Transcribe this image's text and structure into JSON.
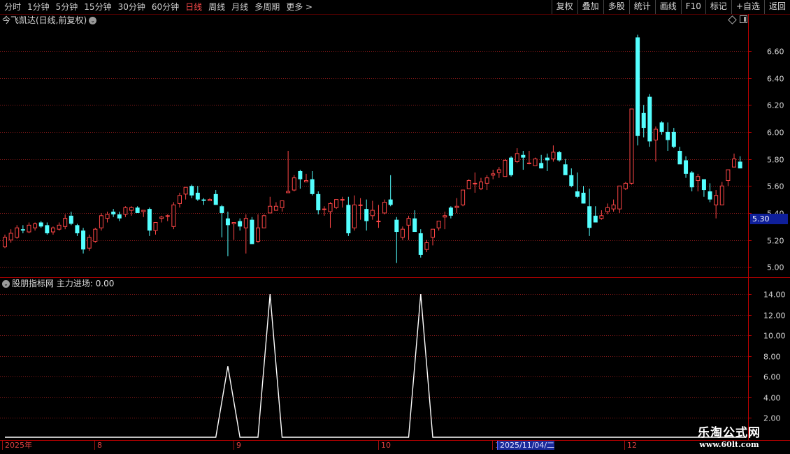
{
  "toolbar": {
    "periods": [
      "分时",
      "1分钟",
      "5分钟",
      "15分钟",
      "30分钟",
      "60分钟",
      "日线",
      "周线",
      "月线",
      "多周期",
      "更多 >"
    ],
    "active_period": "日线",
    "buttons": [
      "复权",
      "叠加",
      "多股",
      "统计",
      "画线",
      "F10",
      "标记",
      "+自选",
      "返回"
    ]
  },
  "main_panel": {
    "title": "今飞凯达(日线,前复权)",
    "current_price_label": "5.30"
  },
  "sub_panel": {
    "title": "股朋指标网",
    "indicator": "主力进场:",
    "indicator_value": "0.00"
  },
  "date_axis": {
    "labels": [
      "2025年",
      "8",
      "9",
      "10",
      "1",
      "2025/11/04/二",
      "12"
    ]
  },
  "watermark": {
    "title": "乐淘公式网",
    "url": "www.60lt.com"
  },
  "colors": {
    "up": "#ff4646",
    "down": "#54ffff",
    "grid": "#8c1a1a",
    "axis": "#c00000",
    "highlight_bg": "#1a2a9a"
  },
  "chart_data": [
    {
      "type": "candlestick",
      "title": "今飞凯达(日线,前复权)",
      "ylim": [
        4.95,
        6.78
      ],
      "y_ticks": [
        5.0,
        5.2,
        5.4,
        5.6,
        5.8,
        6.0,
        6.2,
        6.4,
        6.6
      ],
      "current_price": 5.3,
      "ohlc": [
        [
          5.15,
          5.24,
          5.14,
          5.22
        ],
        [
          5.2,
          5.28,
          5.18,
          5.25
        ],
        [
          5.22,
          5.31,
          5.21,
          5.29
        ],
        [
          5.28,
          5.31,
          5.25,
          5.27
        ],
        [
          5.26,
          5.33,
          5.25,
          5.31
        ],
        [
          5.29,
          5.33,
          5.27,
          5.32
        ],
        [
          5.33,
          5.34,
          5.29,
          5.3
        ],
        [
          5.31,
          5.33,
          5.24,
          5.25
        ],
        [
          5.26,
          5.3,
          5.24,
          5.29
        ],
        [
          5.28,
          5.33,
          5.27,
          5.31
        ],
        [
          5.3,
          5.39,
          5.28,
          5.36
        ],
        [
          5.38,
          5.41,
          5.31,
          5.32
        ],
        [
          5.31,
          5.32,
          5.23,
          5.25
        ],
        [
          5.27,
          5.29,
          5.1,
          5.13
        ],
        [
          5.14,
          5.24,
          5.12,
          5.22
        ],
        [
          5.19,
          5.29,
          5.18,
          5.28
        ],
        [
          5.29,
          5.4,
          5.27,
          5.38
        ],
        [
          5.36,
          5.41,
          5.33,
          5.39
        ],
        [
          5.41,
          5.43,
          5.37,
          5.39
        ],
        [
          5.39,
          5.41,
          5.34,
          5.36
        ],
        [
          5.39,
          5.45,
          5.37,
          5.44
        ],
        [
          5.42,
          5.45,
          5.38,
          5.44
        ],
        [
          5.44,
          5.45,
          5.4,
          5.4
        ],
        [
          5.41,
          5.42,
          5.37,
          5.42
        ],
        [
          5.43,
          5.44,
          5.23,
          5.27
        ],
        [
          5.27,
          5.33,
          5.24,
          5.33
        ],
        [
          5.36,
          5.38,
          5.33,
          5.37
        ],
        [
          5.38,
          5.39,
          5.34,
          5.38
        ],
        [
          5.3,
          5.48,
          5.28,
          5.46
        ],
        [
          5.47,
          5.55,
          5.44,
          5.53
        ],
        [
          5.54,
          5.56,
          5.5,
          5.59
        ],
        [
          5.6,
          5.61,
          5.51,
          5.53
        ],
        [
          5.55,
          5.6,
          5.49,
          5.5
        ],
        [
          5.5,
          5.51,
          5.46,
          5.49
        ],
        [
          5.49,
          5.51,
          5.49,
          5.5
        ],
        [
          5.54,
          5.57,
          5.46,
          5.46
        ],
        [
          5.45,
          5.46,
          5.22,
          5.4
        ],
        [
          5.36,
          5.41,
          5.08,
          5.31
        ],
        [
          5.32,
          5.33,
          5.2,
          5.33
        ],
        [
          5.34,
          5.36,
          5.27,
          5.3
        ],
        [
          5.29,
          5.39,
          5.1,
          5.36
        ],
        [
          5.35,
          5.37,
          5.17,
          5.17
        ],
        [
          5.19,
          5.39,
          5.18,
          5.29
        ],
        [
          5.29,
          5.39,
          5.3,
          5.38
        ],
        [
          5.4,
          5.52,
          5.4,
          5.45
        ],
        [
          5.42,
          5.48,
          5.42,
          5.45
        ],
        [
          5.44,
          5.48,
          5.41,
          5.49
        ],
        [
          5.55,
          5.86,
          5.55,
          5.56
        ],
        [
          5.57,
          5.68,
          5.56,
          5.66
        ],
        [
          5.71,
          5.72,
          5.58,
          5.65
        ],
        [
          5.63,
          5.69,
          5.63,
          5.64
        ],
        [
          5.65,
          5.71,
          5.53,
          5.54
        ],
        [
          5.54,
          5.56,
          5.39,
          5.42
        ],
        [
          5.43,
          5.45,
          5.38,
          5.43
        ],
        [
          5.41,
          5.48,
          5.29,
          5.47
        ],
        [
          5.44,
          5.5,
          5.43,
          5.5
        ],
        [
          5.5,
          5.52,
          5.44,
          5.5
        ],
        [
          5.46,
          5.52,
          5.23,
          5.25
        ],
        [
          5.29,
          5.53,
          5.27,
          5.46
        ],
        [
          5.46,
          5.51,
          5.35,
          5.46
        ],
        [
          5.43,
          5.5,
          5.27,
          5.34
        ],
        [
          5.38,
          5.49,
          5.35,
          5.42
        ],
        [
          5.34,
          5.46,
          5.29,
          5.34
        ],
        [
          5.4,
          5.5,
          5.39,
          5.48
        ],
        [
          5.5,
          5.68,
          5.45,
          5.46
        ],
        [
          5.35,
          5.37,
          5.03,
          5.26
        ],
        [
          5.22,
          5.3,
          5.2,
          5.28
        ],
        [
          5.31,
          5.38,
          5.2,
          5.36
        ],
        [
          5.36,
          5.42,
          5.27,
          5.26
        ],
        [
          5.25,
          5.28,
          5.07,
          5.09
        ],
        [
          5.13,
          5.2,
          5.11,
          5.18
        ],
        [
          5.22,
          5.28,
          5.16,
          5.28
        ],
        [
          5.29,
          5.34,
          5.27,
          5.34
        ],
        [
          5.37,
          5.41,
          5.28,
          5.38
        ],
        [
          5.44,
          5.45,
          5.36,
          5.38
        ],
        [
          5.44,
          5.51,
          5.4,
          5.45
        ],
        [
          5.46,
          5.57,
          5.45,
          5.57
        ],
        [
          5.58,
          5.65,
          5.58,
          5.64
        ],
        [
          5.62,
          5.7,
          5.55,
          5.62
        ],
        [
          5.58,
          5.66,
          5.57,
          5.63
        ],
        [
          5.62,
          5.68,
          5.57,
          5.66
        ],
        [
          5.68,
          5.72,
          5.65,
          5.69
        ],
        [
          5.7,
          5.74,
          5.66,
          5.72
        ],
        [
          5.67,
          5.8,
          5.67,
          5.79
        ],
        [
          5.81,
          5.82,
          5.67,
          5.68
        ],
        [
          5.78,
          5.88,
          5.77,
          5.84
        ],
        [
          5.83,
          5.86,
          5.72,
          5.81
        ],
        [
          5.77,
          5.86,
          5.76,
          5.77
        ],
        [
          5.75,
          5.81,
          5.76,
          5.8
        ],
        [
          5.77,
          5.83,
          5.73,
          5.73
        ],
        [
          5.81,
          5.84,
          5.71,
          5.79
        ],
        [
          5.8,
          5.9,
          5.78,
          5.85
        ],
        [
          5.85,
          5.86,
          5.78,
          5.79
        ],
        [
          5.76,
          5.8,
          5.7,
          5.68
        ],
        [
          5.68,
          5.73,
          5.59,
          5.6
        ],
        [
          5.56,
          5.7,
          5.51,
          5.52
        ],
        [
          5.55,
          5.6,
          5.47,
          5.47
        ],
        [
          5.45,
          5.58,
          5.23,
          5.29
        ],
        [
          5.38,
          5.45,
          5.33,
          5.33
        ],
        [
          5.36,
          5.42,
          5.35,
          5.38
        ],
        [
          5.41,
          5.47,
          5.39,
          5.44
        ],
        [
          5.43,
          5.5,
          5.41,
          5.46
        ],
        [
          5.43,
          5.6,
          5.4,
          5.6
        ],
        [
          5.58,
          5.63,
          5.57,
          5.62
        ],
        [
          5.62,
          6.17,
          5.61,
          6.17
        ],
        [
          6.7,
          6.72,
          5.9,
          5.97
        ],
        [
          6.14,
          6.2,
          5.96,
          6.03
        ],
        [
          6.26,
          6.28,
          5.89,
          5.93
        ],
        [
          5.94,
          6.04,
          5.78,
          6.02
        ],
        [
          6.07,
          6.08,
          5.98,
          6.0
        ],
        [
          6.0,
          6.07,
          5.86,
          5.94
        ],
        [
          6.0,
          6.03,
          5.88,
          5.89
        ],
        [
          5.86,
          5.89,
          5.77,
          5.76
        ],
        [
          5.79,
          5.82,
          5.66,
          5.69
        ],
        [
          5.7,
          5.71,
          5.56,
          5.59
        ],
        [
          5.64,
          5.69,
          5.56,
          5.67
        ],
        [
          5.65,
          5.59,
          5.52,
          5.57
        ],
        [
          5.56,
          5.62,
          5.48,
          5.5
        ],
        [
          5.46,
          5.57,
          5.36,
          5.53
        ],
        [
          5.46,
          5.63,
          5.46,
          5.6
        ],
        [
          5.64,
          5.66,
          5.6,
          5.72
        ],
        [
          5.74,
          5.84,
          5.74,
          5.8
        ],
        [
          5.78,
          5.82,
          5.73,
          5.73
        ]
      ]
    },
    {
      "type": "line",
      "title": "股朋指标网 主力进场",
      "ylim": [
        2.0,
        15.0
      ],
      "y_ticks": [
        2.0,
        4.0,
        6.0,
        8.0,
        10.0,
        12.0,
        14.0
      ],
      "series": [
        {
          "name": "主力进场",
          "points": [
            [
              0,
              0
            ],
            [
              35,
              0
            ],
            [
              37,
              7
            ],
            [
              39,
              0
            ],
            [
              42,
              0
            ],
            [
              44,
              14
            ],
            [
              46,
              0
            ],
            [
              67,
              0
            ],
            [
              69,
              14
            ],
            [
              71,
              0
            ],
            [
              123,
              0
            ]
          ]
        }
      ]
    }
  ]
}
